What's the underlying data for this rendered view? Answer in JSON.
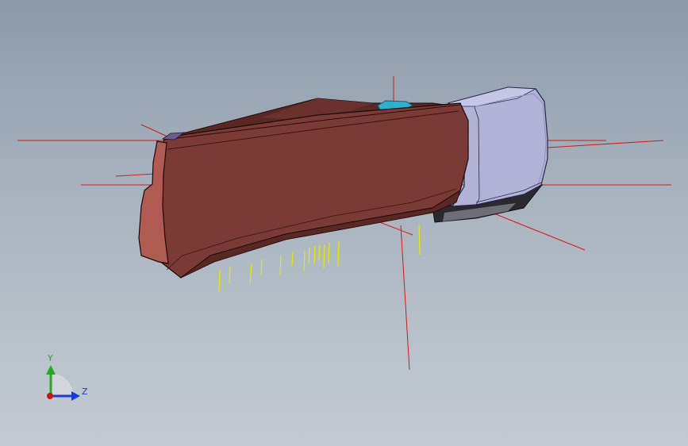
{
  "viewport": {
    "background_top": "#8c9aa9",
    "background_bottom": "#c4cbd2"
  },
  "model": {
    "body_color": "#7a3b36",
    "body_dark": "#5a2824",
    "face_color": "#b05b52",
    "cap_color": "#b3b3d8",
    "cap_dark": "#8e8eb9",
    "base_color": "#2a2a2e",
    "connector_color": "#2fb0cf",
    "sketch_line_color": "#d61818",
    "pin_color": "#e8e800"
  },
  "triad": {
    "y_label": "Y",
    "z_label": "Z",
    "y_color": "#22aa22",
    "z_color": "#1a3bd6",
    "origin_color": "#cc1111"
  }
}
